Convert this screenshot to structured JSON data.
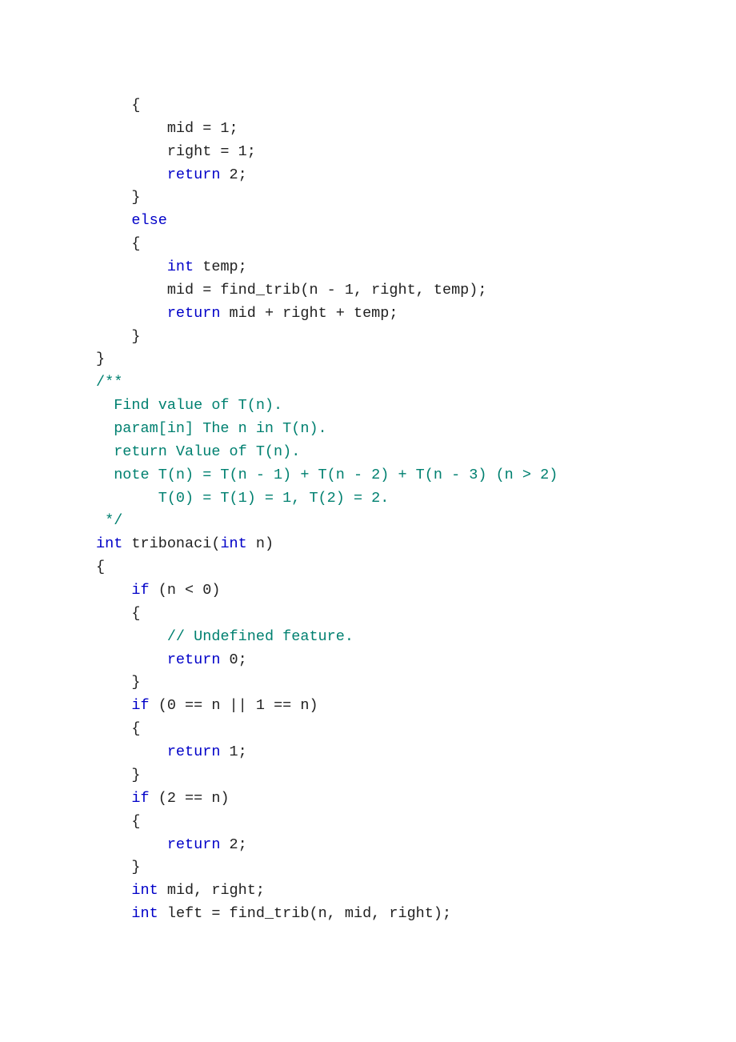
{
  "lines": [
    [
      {
        "t": "    {",
        "c": "pl"
      }
    ],
    [
      {
        "t": "        mid = 1;",
        "c": "pl"
      }
    ],
    [
      {
        "t": "        right = 1;",
        "c": "pl"
      }
    ],
    [
      {
        "t": "        ",
        "c": "pl"
      },
      {
        "t": "return",
        "c": "kw"
      },
      {
        "t": " 2;",
        "c": "pl"
      }
    ],
    [
      {
        "t": "    }",
        "c": "pl"
      }
    ],
    [
      {
        "t": "    ",
        "c": "pl"
      },
      {
        "t": "else",
        "c": "kw"
      }
    ],
    [
      {
        "t": "    {",
        "c": "pl"
      }
    ],
    [
      {
        "t": "        ",
        "c": "pl"
      },
      {
        "t": "int",
        "c": "kw"
      },
      {
        "t": " temp;",
        "c": "pl"
      }
    ],
    [
      {
        "t": "        mid = find_trib(n - 1, right, temp);",
        "c": "pl"
      }
    ],
    [
      {
        "t": "        ",
        "c": "pl"
      },
      {
        "t": "return",
        "c": "kw"
      },
      {
        "t": " mid + right + temp;",
        "c": "pl"
      }
    ],
    [
      {
        "t": "    }",
        "c": "pl"
      }
    ],
    [
      {
        "t": "}",
        "c": "pl"
      }
    ],
    [
      {
        "t": "/**",
        "c": "cm"
      }
    ],
    [
      {
        "t": "  Find value of T(n).",
        "c": "cm"
      }
    ],
    [
      {
        "t": "  param[in] The n in T(n).",
        "c": "cm"
      }
    ],
    [
      {
        "t": "  return Value of T(n).",
        "c": "cm"
      }
    ],
    [
      {
        "t": "  note T(n) = T(n - 1) + T(n - 2) + T(n - 3) (n > 2)",
        "c": "cm"
      }
    ],
    [
      {
        "t": "       T(0) = T(1) = 1, T(2) = 2.",
        "c": "cm"
      }
    ],
    [
      {
        "t": " */",
        "c": "cm"
      }
    ],
    [
      {
        "t": "int",
        "c": "kw"
      },
      {
        "t": " tribonaci(",
        "c": "pl"
      },
      {
        "t": "int",
        "c": "kw"
      },
      {
        "t": " n)",
        "c": "pl"
      }
    ],
    [
      {
        "t": "{",
        "c": "pl"
      }
    ],
    [
      {
        "t": "    ",
        "c": "pl"
      },
      {
        "t": "if",
        "c": "kw"
      },
      {
        "t": " (n < 0)",
        "c": "pl"
      }
    ],
    [
      {
        "t": "    {",
        "c": "pl"
      }
    ],
    [
      {
        "t": "        ",
        "c": "pl"
      },
      {
        "t": "// Undefined feature.",
        "c": "cm"
      }
    ],
    [
      {
        "t": "        ",
        "c": "pl"
      },
      {
        "t": "return",
        "c": "kw"
      },
      {
        "t": " 0;",
        "c": "pl"
      }
    ],
    [
      {
        "t": "    }",
        "c": "pl"
      }
    ],
    [
      {
        "t": "    ",
        "c": "pl"
      },
      {
        "t": "if",
        "c": "kw"
      },
      {
        "t": " (0 == n || 1 == n)",
        "c": "pl"
      }
    ],
    [
      {
        "t": "    {",
        "c": "pl"
      }
    ],
    [
      {
        "t": "        ",
        "c": "pl"
      },
      {
        "t": "return",
        "c": "kw"
      },
      {
        "t": " 1;",
        "c": "pl"
      }
    ],
    [
      {
        "t": "    }",
        "c": "pl"
      }
    ],
    [
      {
        "t": "    ",
        "c": "pl"
      },
      {
        "t": "if",
        "c": "kw"
      },
      {
        "t": " (2 == n)",
        "c": "pl"
      }
    ],
    [
      {
        "t": "    {",
        "c": "pl"
      }
    ],
    [
      {
        "t": "        ",
        "c": "pl"
      },
      {
        "t": "return",
        "c": "kw"
      },
      {
        "t": " 2;",
        "c": "pl"
      }
    ],
    [
      {
        "t": "    }",
        "c": "pl"
      }
    ],
    [
      {
        "t": "    ",
        "c": "pl"
      },
      {
        "t": "int",
        "c": "kw"
      },
      {
        "t": " mid, right;",
        "c": "pl"
      }
    ],
    [
      {
        "t": "    ",
        "c": "pl"
      },
      {
        "t": "int",
        "c": "kw"
      },
      {
        "t": " left = find_trib(n, mid, right);",
        "c": "pl"
      }
    ]
  ]
}
